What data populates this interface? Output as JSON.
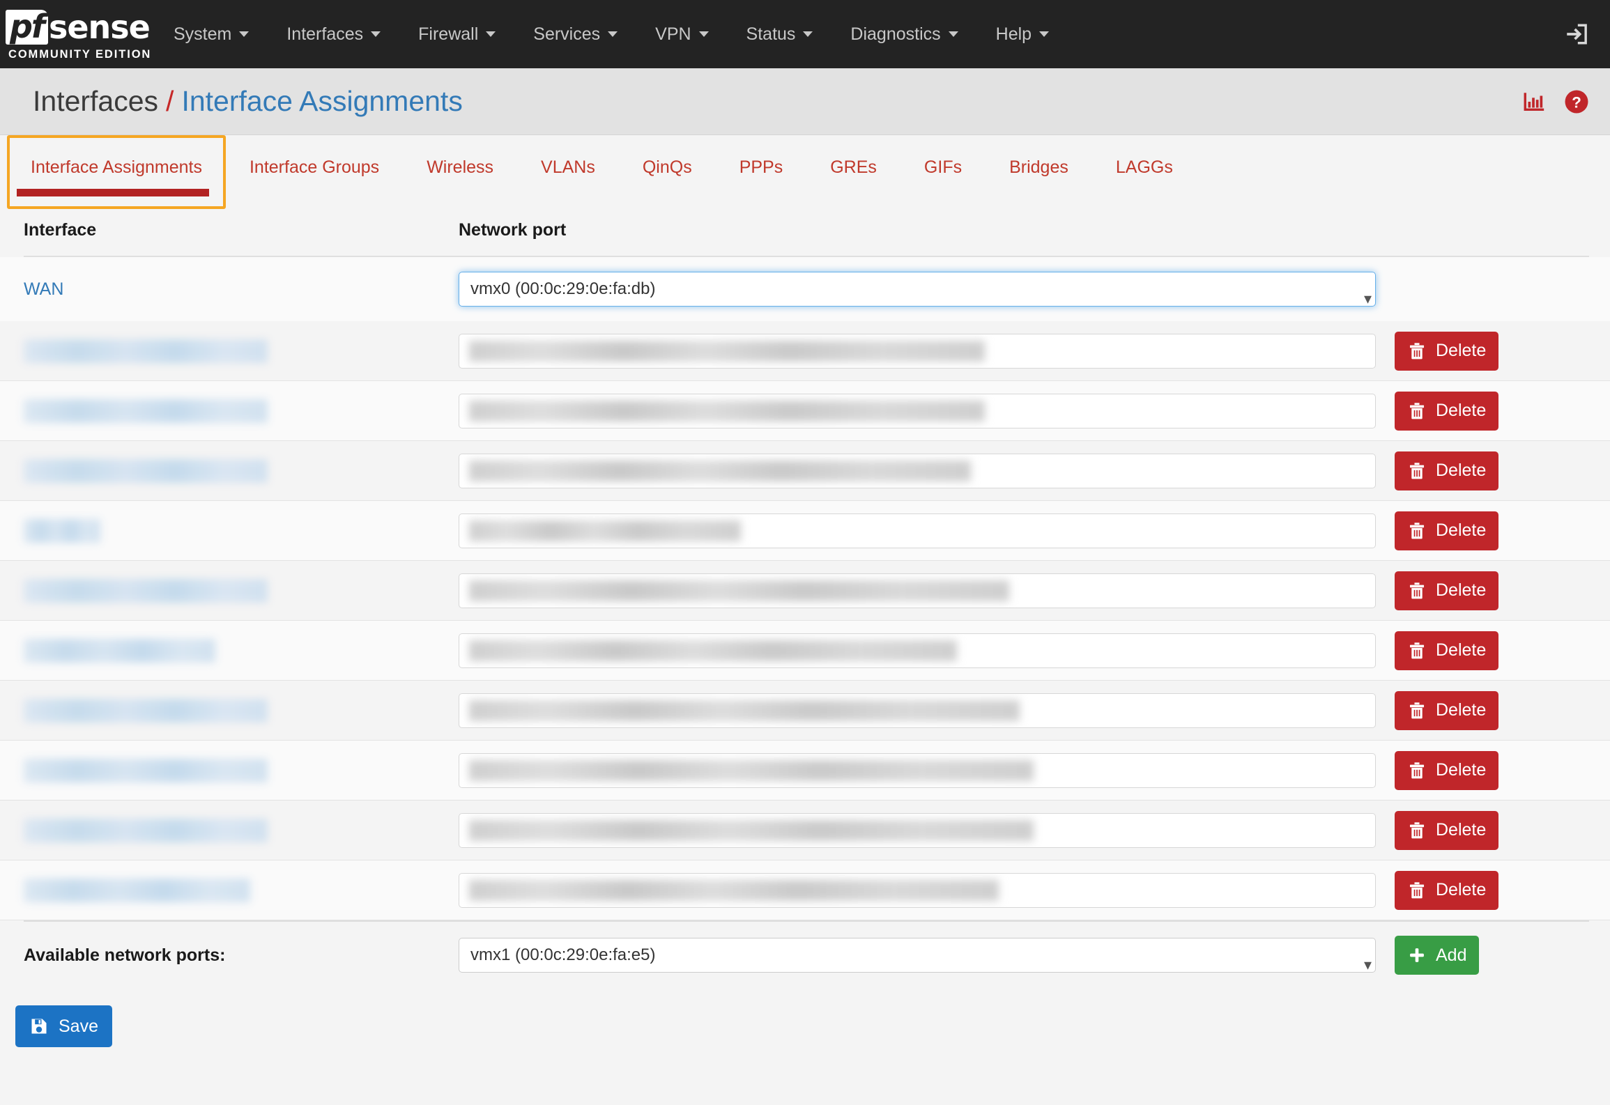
{
  "navbar": {
    "brand": {
      "pf": "pf",
      "sense": "sense",
      "subtitle": "COMMUNITY EDITION"
    },
    "items": [
      {
        "label": "System",
        "has_caret": true
      },
      {
        "label": "Interfaces",
        "has_caret": true
      },
      {
        "label": "Firewall",
        "has_caret": true
      },
      {
        "label": "Services",
        "has_caret": true
      },
      {
        "label": "VPN",
        "has_caret": true
      },
      {
        "label": "Status",
        "has_caret": true
      },
      {
        "label": "Diagnostics",
        "has_caret": true
      },
      {
        "label": "Help",
        "has_caret": true
      }
    ],
    "logout_icon": "logout-icon"
  },
  "header": {
    "breadcrumb_root": "Interfaces",
    "breadcrumb_separator": "/",
    "breadcrumb_leaf": "Interface Assignments",
    "icons": [
      "chart-icon",
      "help-icon"
    ]
  },
  "tabs": [
    {
      "label": "Interface Assignments",
      "active": true
    },
    {
      "label": "Interface Groups",
      "active": false
    },
    {
      "label": "Wireless",
      "active": false
    },
    {
      "label": "VLANs",
      "active": false
    },
    {
      "label": "QinQs",
      "active": false
    },
    {
      "label": "PPPs",
      "active": false
    },
    {
      "label": "GREs",
      "active": false
    },
    {
      "label": "GIFs",
      "active": false
    },
    {
      "label": "Bridges",
      "active": false
    },
    {
      "label": "LAGGs",
      "active": false
    }
  ],
  "table": {
    "headers": {
      "interface": "Interface",
      "network_port": "Network port"
    },
    "wan_row": {
      "interface_label": "WAN",
      "port_value": "vmx0 (00:0c:29:0e:fa:db)",
      "focused": true
    },
    "redacted_rows": [
      {
        "name_width": 350,
        "sel_text_width": 740,
        "delete_label": "Delete"
      },
      {
        "name_width": 350,
        "sel_text_width": 740,
        "delete_label": "Delete"
      },
      {
        "name_width": 350,
        "sel_text_width": 720,
        "delete_label": "Delete"
      },
      {
        "name_width": 110,
        "sel_text_width": 390,
        "delete_label": "Delete"
      },
      {
        "name_width": 350,
        "sel_text_width": 775,
        "delete_label": "Delete"
      },
      {
        "name_width": 275,
        "sel_text_width": 700,
        "delete_label": "Delete"
      },
      {
        "name_width": 350,
        "sel_text_width": 790,
        "delete_label": "Delete"
      },
      {
        "name_width": 350,
        "sel_text_width": 810,
        "delete_label": "Delete"
      },
      {
        "name_width": 350,
        "sel_text_width": 810,
        "delete_label": "Delete"
      },
      {
        "name_width": 325,
        "sel_text_width": 760,
        "delete_label": "Delete"
      }
    ]
  },
  "footer": {
    "available_ports_label": "Available network ports:",
    "available_ports_value": "vmx1 (00:0c:29:0e:fa:e5)",
    "add_label": "Add",
    "save_label": "Save"
  },
  "colors": {
    "navbar_bg": "#232323",
    "accent_red": "#c0392b",
    "link_blue": "#337ab7",
    "delete_red": "#c0262a",
    "add_green": "#389d45",
    "save_blue": "#1c73c4",
    "highlight_orange": "#f5a623"
  }
}
